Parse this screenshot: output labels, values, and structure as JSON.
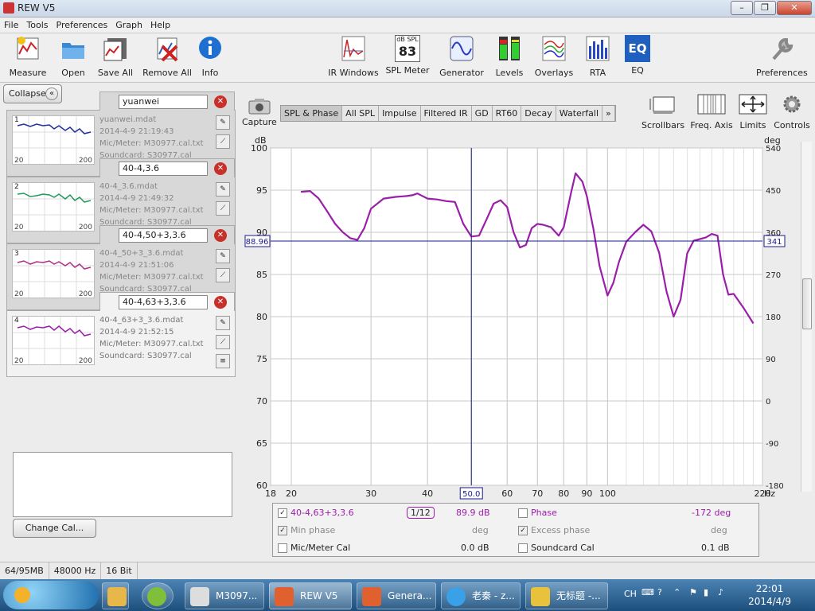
{
  "window": {
    "title": "REW V5",
    "controls": [
      "–",
      "❐",
      "✕"
    ]
  },
  "menu": [
    "File",
    "Tools",
    "Preferences",
    "Graph",
    "Help"
  ],
  "toolbar": {
    "left": [
      {
        "label": "Measure",
        "icon": "measure-icon"
      },
      {
        "label": "Open",
        "icon": "folder-icon"
      },
      {
        "label": "Save All",
        "icon": "save-icon"
      },
      {
        "label": "Remove All",
        "icon": "remove-icon"
      },
      {
        "label": "Info",
        "icon": "info-icon"
      }
    ],
    "center": [
      {
        "label": "IR Windows",
        "icon": "ir-windows-icon"
      },
      {
        "label": "SPL Meter",
        "icon": "spl-meter-icon",
        "badge_top": "dB SPL",
        "badge_value": "83"
      },
      {
        "label": "Generator",
        "icon": "generator-icon"
      },
      {
        "label": "Levels",
        "icon": "levels-icon"
      },
      {
        "label": "Overlays",
        "icon": "overlays-icon"
      },
      {
        "label": "RTA",
        "icon": "rta-icon"
      },
      {
        "label": "EQ",
        "icon": "eq-icon",
        "badge_value": "EQ"
      }
    ],
    "right": {
      "label": "Preferences",
      "icon": "wrench-icon"
    }
  },
  "panel": {
    "collapse_label": "Collapse",
    "collapse_icon": "«",
    "measurements": [
      {
        "num": "1",
        "name": "yuanwei",
        "file": "yuanwei.mdat",
        "date": "2014-4-9 21:19:43",
        "mic": "Mic/Meter: M30977.cal.txt",
        "soundcard": "Soundcard: S30977.cal",
        "color": "#1f2e9a"
      },
      {
        "num": "2",
        "name": "40-4,3.6",
        "file": "40-4_3.6.mdat",
        "date": "2014-4-9 21:49:32",
        "mic": "Mic/Meter: M30977.cal.txt",
        "soundcard": "Soundcard: S30977.cal",
        "color": "#1f9a5a"
      },
      {
        "num": "3",
        "name": "40-4,50+3,3.6",
        "file": "40-4_50+3_3.6.mdat",
        "date": "2014-4-9 21:51:06",
        "mic": "Mic/Meter: M30977.cal.txt",
        "soundcard": "Soundcard: S30977.cal",
        "color": "#b0308a"
      },
      {
        "num": "4",
        "name": "40-4,63+3,3.6",
        "file": "40-4_63+3_3.6.mdat",
        "date": "2014-4-9 21:52:15",
        "mic": "Mic/Meter: M30977.cal.txt",
        "soundcard": "Soundcard: S30977.cal",
        "color": "#9a1fa8"
      }
    ],
    "thumb_x_min": "20",
    "thumb_x_max": "200",
    "change_cal_label": "Change Cal..."
  },
  "capture_label": "Capture",
  "tabs": [
    "SPL & Phase",
    "All SPL",
    "Impulse",
    "Filtered IR",
    "GD",
    "RT60",
    "Decay",
    "Waterfall",
    "»"
  ],
  "active_tab": "SPL & Phase",
  "right_tools": [
    {
      "label": "Scrollbars",
      "icon": "scrollbars-icon"
    },
    {
      "label": "Freq. Axis",
      "icon": "freq-axis-icon"
    },
    {
      "label": "Limits",
      "icon": "limits-icon"
    },
    {
      "label": "Controls",
      "icon": "gear-icon"
    }
  ],
  "chart_data": {
    "type": "line",
    "xlabel": "Hz",
    "ylabel": "dB",
    "y2label": "deg",
    "xscale": "log",
    "xlim": [
      18,
      220
    ],
    "ylim": [
      60,
      100
    ],
    "y2lim": [
      -180,
      540
    ],
    "xticks": [
      18,
      20,
      30,
      40,
      50,
      60,
      70,
      80,
      90,
      100,
      220
    ],
    "yticks": [
      60,
      65,
      70,
      75,
      80,
      85,
      90,
      95,
      100
    ],
    "y2ticks": [
      -180,
      -90,
      0,
      90,
      180,
      270,
      360,
      450,
      540
    ],
    "grid": true,
    "cursor": {
      "x": 50.0,
      "x_label": "50.0",
      "y": 88.96,
      "y_label": "88.96",
      "y2_label": "341"
    },
    "series": [
      {
        "name": "40-4,63+3,3.6",
        "color": "#9a1fa8",
        "x": [
          21,
          22,
          23,
          24,
          25,
          26,
          27,
          28,
          29,
          30,
          32,
          34,
          36,
          37,
          38,
          40,
          42,
          44,
          46,
          48,
          50,
          52,
          54,
          56,
          58,
          60,
          62,
          64,
          66,
          68,
          70,
          72,
          75,
          78,
          80,
          83,
          85,
          88,
          90,
          93,
          96,
          100,
          103,
          106,
          110,
          115,
          120,
          125,
          130,
          135,
          140,
          145,
          150,
          155,
          160,
          165,
          170,
          175,
          180,
          185,
          190,
          200,
          210
        ],
        "y": [
          94.8,
          94.9,
          94.0,
          92.5,
          91.0,
          90.0,
          89.3,
          89.1,
          90.5,
          92.8,
          94.0,
          94.2,
          94.3,
          94.4,
          94.6,
          94.0,
          93.9,
          93.7,
          93.6,
          91.0,
          89.5,
          89.6,
          91.5,
          93.4,
          93.8,
          93.0,
          90.0,
          88.2,
          88.5,
          90.5,
          91.0,
          90.9,
          90.6,
          89.6,
          90.6,
          94.6,
          97.0,
          96.0,
          94.3,
          90.5,
          86.0,
          82.5,
          84.0,
          86.5,
          88.9,
          90.0,
          90.9,
          90.1,
          87.6,
          83.0,
          80.0,
          82.0,
          87.5,
          89.0,
          89.2,
          89.4,
          89.8,
          89.6,
          85.0,
          82.6,
          82.7,
          81.0,
          79.2
        ]
      }
    ]
  },
  "legend": {
    "row1": {
      "name": "40-4,63+3,3.6",
      "smoothing": "1/12",
      "value": "89.9 dB",
      "phase_label": "Phase",
      "phase_value": "-172 deg"
    },
    "row2": {
      "min_phase_label": "Min phase",
      "min_phase_unit": "deg",
      "excess_phase_label": "Excess phase",
      "excess_phase_unit": "deg"
    },
    "row3": {
      "mic_cal_label": "Mic/Meter Cal",
      "mic_cal_value": "0.0 dB",
      "soundcard_cal_label": "Soundcard Cal",
      "soundcard_cal_value": "0.1 dB"
    }
  },
  "status": {
    "memory": "64/95MB",
    "rate": "48000 Hz",
    "bits": "16 Bit"
  },
  "taskbar": {
    "items": [
      {
        "label": "M3097..."
      },
      {
        "label": "REW V5"
      },
      {
        "label": "Genera..."
      },
      {
        "label": "老秦 - z..."
      },
      {
        "label": "无标题 -..."
      }
    ],
    "lang": "CH",
    "time": "22:01",
    "date": "2014/4/9"
  }
}
